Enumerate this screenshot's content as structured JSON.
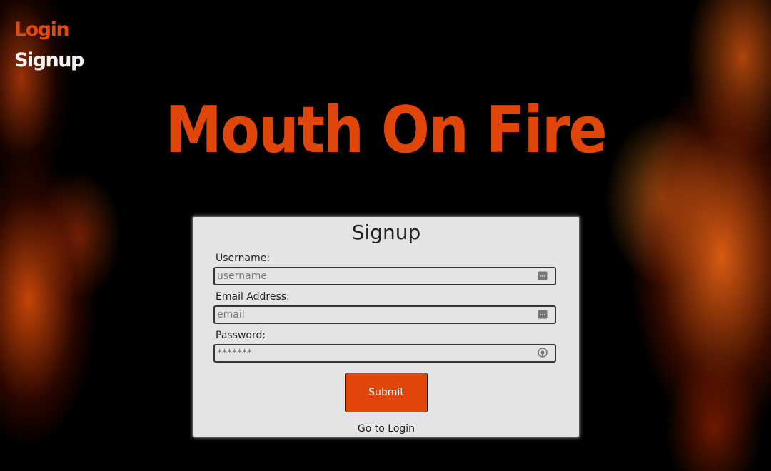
{
  "nav": {
    "login_label": "Login",
    "signup_label": "Signup"
  },
  "hero": {
    "title": "Mouth On Fire"
  },
  "form": {
    "title": "Signup",
    "username_label": "Username:",
    "username_placeholder": "username",
    "username_value": "",
    "email_label": "Email Address:",
    "email_placeholder": "email",
    "email_value": "",
    "password_label": "Password:",
    "password_placeholder": "*******",
    "password_value": "",
    "submit_label": "Submit",
    "switch_link_label": "Go to Login"
  },
  "icons": {
    "username_field_icon": "password-manager-icon",
    "email_field_icon": "password-manager-icon",
    "password_field_icon": "password-reveal-icon"
  },
  "colors": {
    "accent": "#e0460a",
    "card_background": "#e4e4e4",
    "page_background": "#000000",
    "nav_active": "#e04a0a",
    "nav_inactive": "#f1f1f1"
  }
}
